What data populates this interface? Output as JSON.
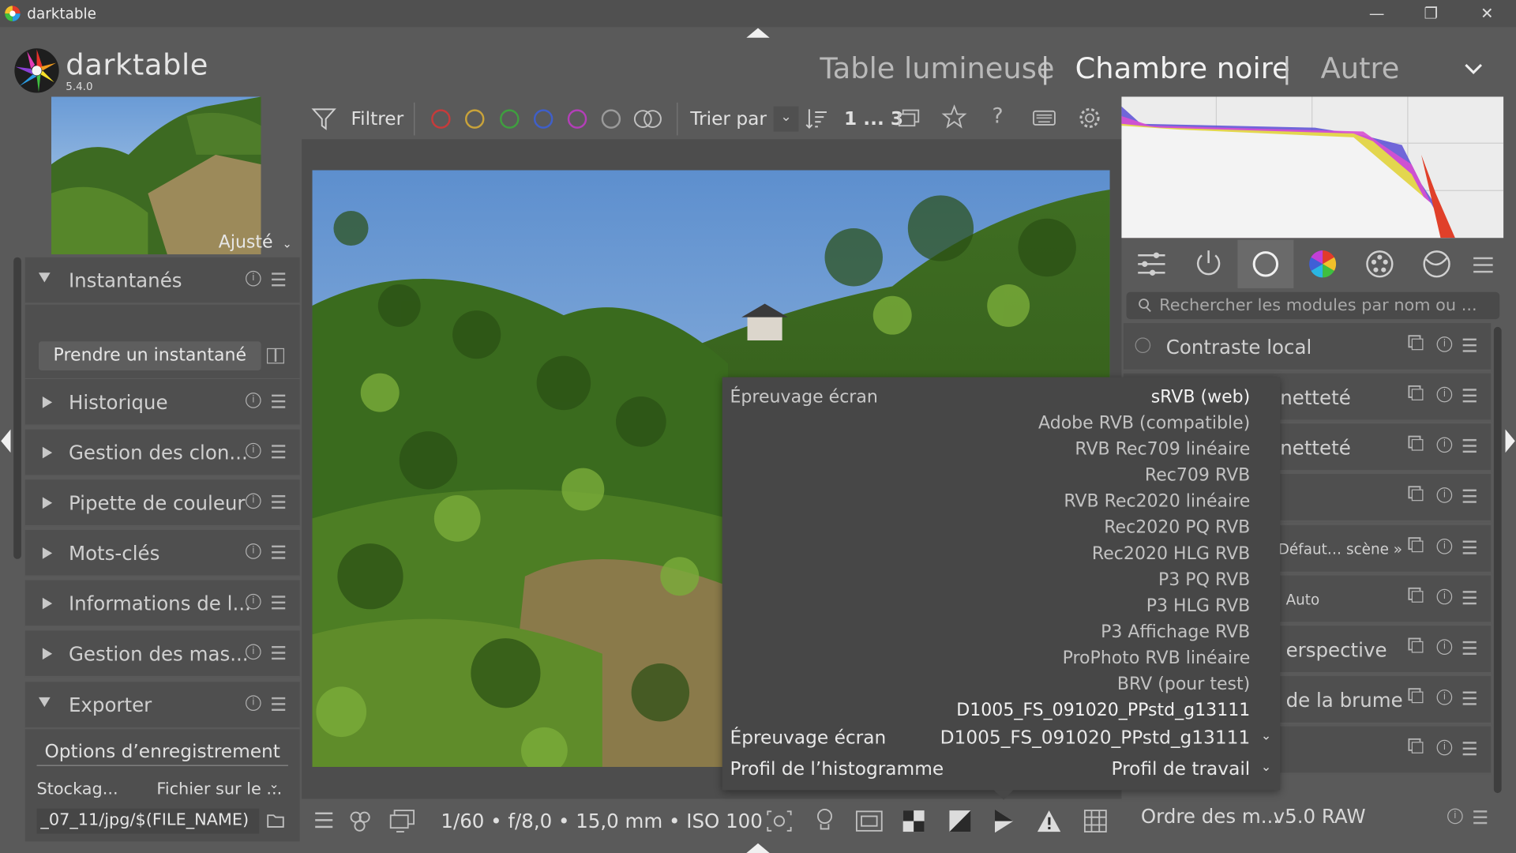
{
  "titlebar": {
    "title": "darktable",
    "min": "—",
    "max": "❐",
    "close": "✕"
  },
  "header": {
    "app_name": "darktable",
    "version": "5.4.0",
    "views": [
      "Table lumineuse",
      "Chambre noire",
      "Autre"
    ],
    "separator": "|",
    "active_view": "Chambre noire"
  },
  "left": {
    "zoom_label": "Ajusté",
    "snapshots": {
      "title": "Instantanés",
      "take_button": "Prendre un instantané"
    },
    "modules": [
      "Historique",
      "Gestion des clon...",
      "Pipette de couleur",
      "Mots-clés",
      "Informations de l...",
      "Gestion des mas..."
    ],
    "export": {
      "title": "Exporter",
      "options_header": "Options d’enregistrement",
      "storage_label": "Stockag...",
      "storage_value": "Fichier sur le ...",
      "path_value": "_07_11/jpg/$(FILE_NAME)"
    }
  },
  "filterbar": {
    "filter_label": "Filtrer",
    "sort_label": "Trier par",
    "count": "1 ... 3",
    "color_labels": [
      "#c63b3b",
      "#c9a33a",
      "#3f9f3f",
      "#3f5fc9",
      "#b33fb8",
      "#9a9a9a"
    ]
  },
  "right": {
    "search_placeholder": "Rechercher les modules par nom ou ...",
    "modules": [
      "Contraste local",
      "netteté",
      "netteté",
      "",
      "Défaut… scène »",
      "Auto",
      "erspective",
      "de la brume",
      ""
    ],
    "bottom_label": "Ordre des m...",
    "bottom_value": "v5.0 RAW"
  },
  "bottombar": {
    "exif": "1/60 • f/8,0 • 15,0 mm • ISO 100"
  },
  "popup": {
    "header": "Épreuvage écran",
    "options": [
      "sRVB (web)",
      "Adobe RVB (compatible)",
      "RVB Rec709 linéaire",
      "Rec709 RVB",
      "RVB Rec2020 linéaire",
      "Rec2020 PQ RVB",
      "Rec2020 HLG RVB",
      "P3 PQ RVB",
      "P3 HLG RVB",
      "P3 Affichage RVB",
      "ProPhoto RVB linéaire",
      "BRV (pour test)",
      "D1005_FS_091020_PPstd_g13111"
    ],
    "selected": "sRVB (web)",
    "softproof_label": "Épreuvage écran",
    "softproof_value": "D1005_FS_091020_PPstd_g13111",
    "histogram_label": "Profil de l’histogramme",
    "histogram_value": "Profil de travail"
  }
}
